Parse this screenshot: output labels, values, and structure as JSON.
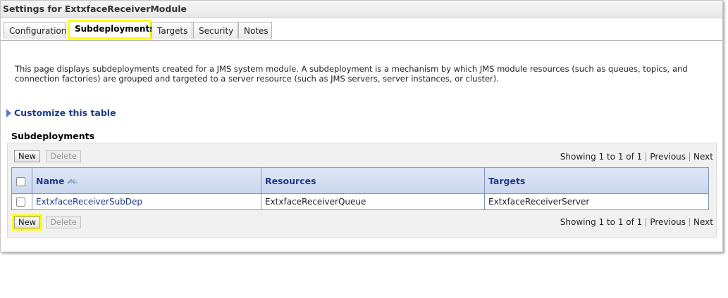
{
  "window": {
    "title": "Settings for ExtxfaceReceiverModule"
  },
  "tabs": [
    {
      "label": "Configuration",
      "active": false
    },
    {
      "label": "Subdeployments",
      "active": true
    },
    {
      "label": "Targets",
      "active": false
    },
    {
      "label": "Security",
      "active": false
    },
    {
      "label": "Notes",
      "active": false
    }
  ],
  "description": "This page displays subdeployments created for a JMS system module. A subdeployment is a mechanism by which JMS module resources (such as queues, topics, and connection factories) are grouped and targeted to a server resource (such as JMS servers, server instances, or cluster).",
  "customize": {
    "label": "Customize this table"
  },
  "section": {
    "title": "Subdeployments"
  },
  "toolbar": {
    "new_label": "New",
    "delete_label": "Delete"
  },
  "pager": {
    "showing": "Showing 1 to 1 of 1",
    "previous": "Previous",
    "next": "Next"
  },
  "table": {
    "columns": [
      "Name",
      "Resources",
      "Targets"
    ],
    "rows": [
      {
        "name": "ExtxfaceReceiverSubDep",
        "resources": "ExtxfaceReceiverQueue",
        "targets": "ExtxfaceReceiverServer"
      }
    ]
  },
  "colors": {
    "link": "#1f3b8e",
    "highlight": "#ffff00",
    "header_bg": "#c9d6ee"
  }
}
